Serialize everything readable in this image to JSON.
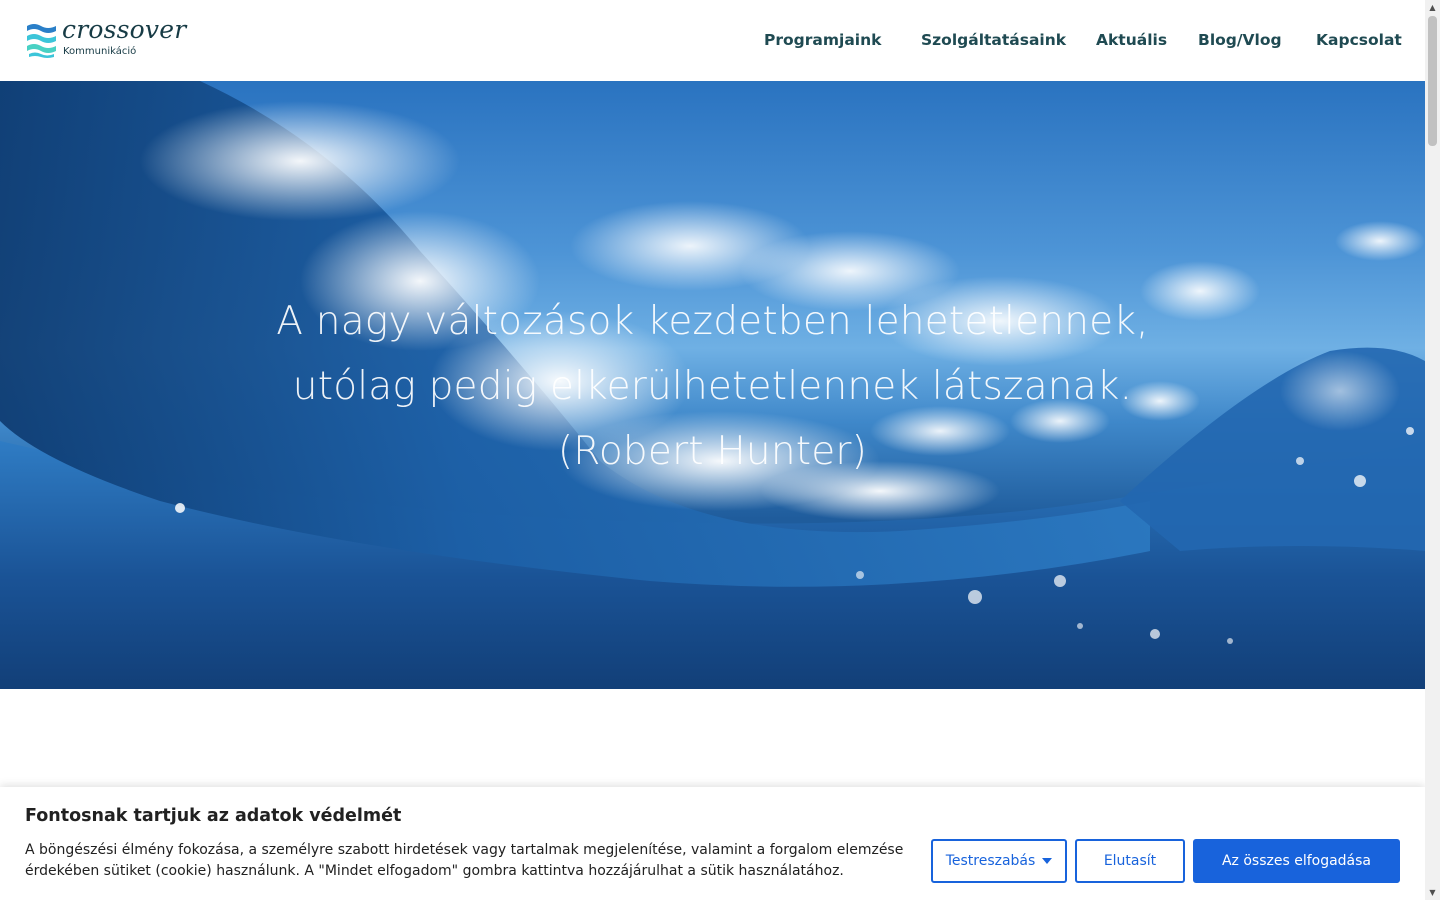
{
  "header": {
    "logo": {
      "name": "crossover",
      "subtitle": "Kommunikáció"
    },
    "nav": [
      {
        "label": "Programjaink"
      },
      {
        "label": "Szolgáltatásaink"
      },
      {
        "label": "Aktuális"
      },
      {
        "label": "Blog/Vlog"
      },
      {
        "label": "Kapcsolat"
      }
    ]
  },
  "hero": {
    "quote_line1": "A nagy változások kezdetben lehetetlennek,",
    "quote_line2": "utólag pedig elkerülhetetlennek látszanak.",
    "quote_author": "(Robert Hunter)"
  },
  "cookie_banner": {
    "title": "Fontosnak tartjuk az adatok védelmét",
    "text": "A böngészési élmény fokozása, a személyre szabott hirdetések vagy tartalmak megjelenítése, valamint a forgalom elemzése érdekében sütiket (cookie) használunk. A \"Mindet elfogadom\" gombra kattintva hozzájárulhat a sütik használatához.",
    "customize_label": "Testreszabás",
    "reject_label": "Elutasít",
    "accept_label": "Az összes elfogadása"
  },
  "colors": {
    "brand_teal": "#1f4a52",
    "logo_cyan": "#3cc5d9",
    "accent_blue": "#1863dc"
  },
  "icons": {
    "logo_mark": "wave-bars-icon",
    "customize_caret": "caret-down-icon"
  }
}
